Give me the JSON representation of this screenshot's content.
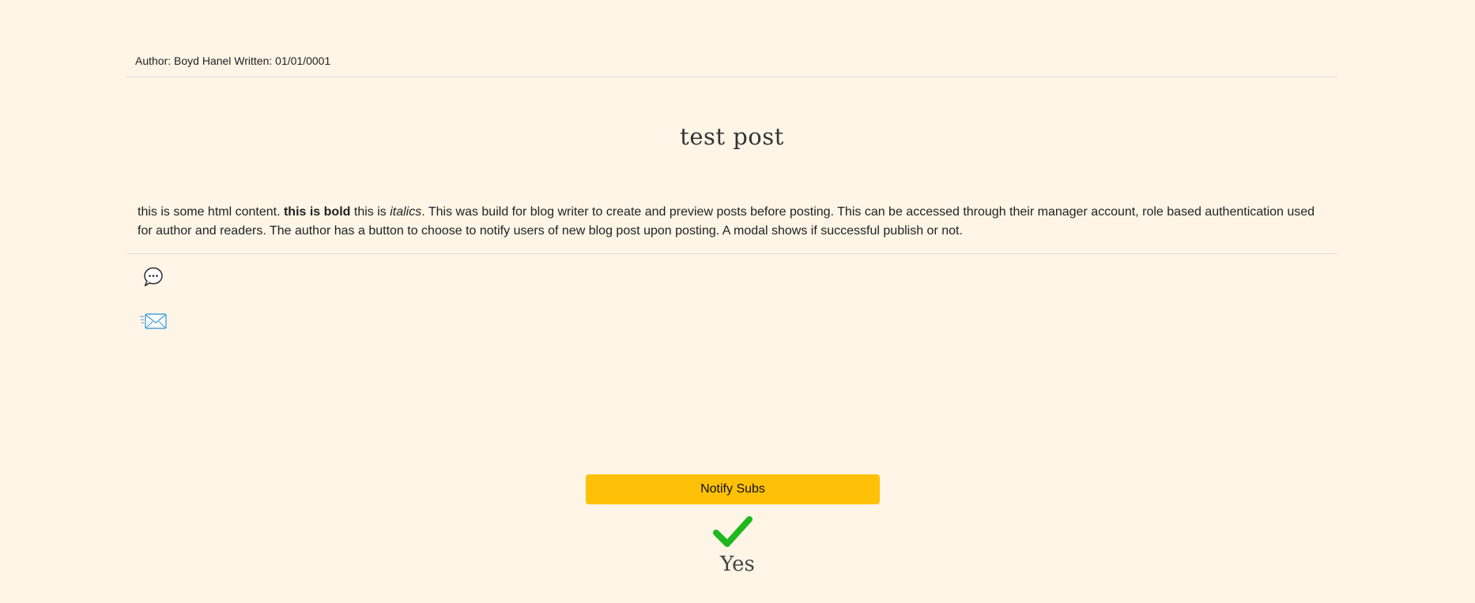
{
  "post": {
    "meta": "Author: Boyd Hanel Written: 01/01/0001",
    "title": "test post",
    "content": {
      "part1": "this is some html content. ",
      "bold": "this is bold",
      "part2": " this is ",
      "italic": "italics",
      "part3": ". This was build for blog writer to create and preview posts before posting. This can be accessed through their manager account, role based authentication used for author and readers. The author has a button to choose to notify users of new blog post upon posting. A modal shows if successful publish or not."
    }
  },
  "actions": {
    "comment_icon": "comment-bubble-icon",
    "mail_icon": "envelope-icon",
    "notify_label": "Notify Subs"
  },
  "status": {
    "icon": "check-icon",
    "color": "#1fb81f",
    "text": "Yes"
  },
  "colors": {
    "background": "#fef5e7",
    "button": "#ffc107"
  }
}
